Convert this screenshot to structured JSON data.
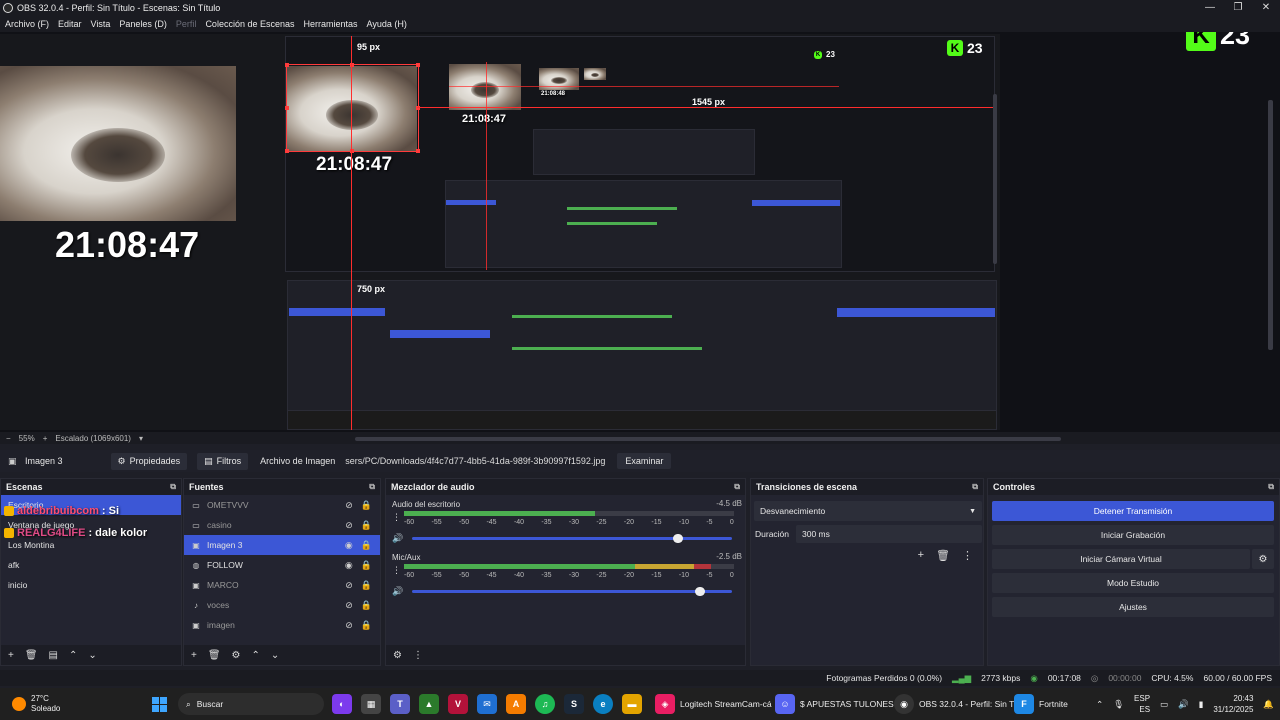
{
  "window": {
    "title": "OBS 32.0.4 - Perfil: Sin Título - Escenas: Sin Título",
    "controls": [
      "—",
      "❐",
      "✕"
    ]
  },
  "menu": [
    "Archivo (F)",
    "Editar",
    "Vista",
    "Paneles (D)",
    "Perfil",
    "Colección de Escenas",
    "Herramientas",
    "Ayuda (H)"
  ],
  "preview": {
    "clock_large": "21:08:47",
    "clock_mid": "21:08:47",
    "clock_small": "21:08:47",
    "clock_tiny": "21:08:48",
    "kick_count": "23",
    "px_top": "95 px",
    "px_right": "1545 px",
    "px_left": "750 px",
    "chat": [
      {
        "user": "aldebribuibcom",
        "text": ": Si"
      },
      {
        "user": "REALG4LIFE",
        "text": ": dale kolor"
      }
    ]
  },
  "zoom": {
    "minus": "−",
    "level": "55%",
    "plus": "+",
    "scale": "Escalado (1069x601)"
  },
  "properties_bar": {
    "source": "Imagen 3",
    "properties_btn": "Propiedades",
    "filters_btn": "Filtros",
    "file_label": "Archivo de Imagen",
    "path": "sers/PC/Downloads/4f4c7d77-4bb5-41da-989f-3b90997f1592.jpg",
    "browse": "Examinar"
  },
  "scenes": {
    "title": "Escenas",
    "items": [
      "Escritorio",
      "Ventana de juego",
      "Los Montina",
      "afk",
      "inicio"
    ],
    "selected": 0
  },
  "sources": {
    "title": "Fuentes",
    "items": [
      {
        "name": "OMETVVV",
        "icon": "window-icon",
        "visible": false
      },
      {
        "name": "casino",
        "icon": "window-icon",
        "visible": false
      },
      {
        "name": "Imagen 3",
        "icon": "image-icon",
        "visible": true
      },
      {
        "name": "FOLLOW",
        "icon": "browser-icon",
        "visible": true
      },
      {
        "name": "MARCO",
        "icon": "image-icon",
        "visible": false
      },
      {
        "name": "voces",
        "icon": "audio-icon",
        "visible": false
      },
      {
        "name": "imagen",
        "icon": "image-icon",
        "visible": false
      }
    ],
    "selected": 2
  },
  "audio": {
    "title": "Mezclador de audio",
    "ticks": [
      "-60",
      "-55",
      "-50",
      "-45",
      "-40",
      "-35",
      "-30",
      "-25",
      "-20",
      "-15",
      "-10",
      "-5",
      "0"
    ],
    "channels": [
      {
        "name": "Audio del escritorio",
        "db": "-4.5 dB",
        "level": 0.58,
        "volume": 0.83
      },
      {
        "name": "Mic/Aux",
        "db": "-2.5 dB",
        "level": 0.93,
        "volume": 0.9
      }
    ]
  },
  "transitions": {
    "title": "Transiciones de escena",
    "selected": "Desvanecimiento",
    "duration_label": "Duración",
    "duration": "300 ms"
  },
  "controls": {
    "title": "Controles",
    "buttons": [
      "Detener Transmisión",
      "Iniciar Grabación",
      "Iniciar Cámara Virtual",
      "Modo Estudio",
      "Ajustes"
    ]
  },
  "status": {
    "dropped": "Fotogramas Perdidos 0 (0.0%)",
    "bitrate": "2773 kbps",
    "stream_time": "00:17:08",
    "rec_time": "00:00:00",
    "cpu": "CPU: 4.5%",
    "fps": "60.00 / 60.00 FPS"
  },
  "taskbar": {
    "temp": "27°C",
    "weather": "Soleado",
    "search": "Buscar",
    "tasks": [
      "Logitech StreamCam-cá",
      "$ APUESTAS TULONES $",
      "OBS 32.0.4 - Perfil: Sin T",
      "Fortnite"
    ],
    "lang": "ESP",
    "lang2": "ES",
    "time": "20:43",
    "date": "31/12/2025"
  }
}
